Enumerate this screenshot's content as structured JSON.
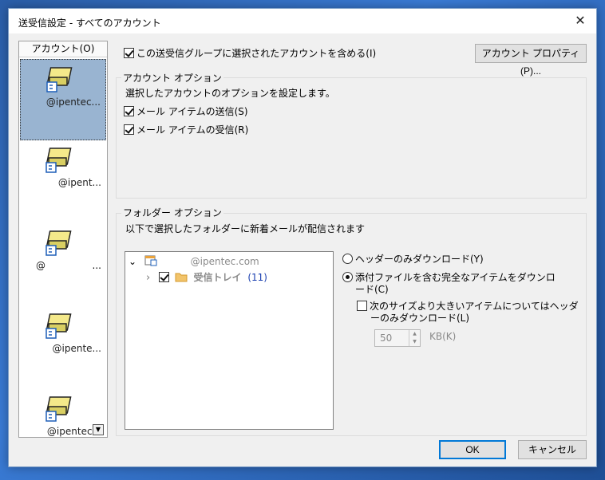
{
  "window": {
    "title": "送受信設定 - すべてのアカウント",
    "close_glyph": "✕"
  },
  "accounts": {
    "header": "アカウント(O)",
    "items": [
      {
        "label": "@ipentec...",
        "selected": true
      },
      {
        "label": "@ipent..."
      },
      {
        "label": "@",
        "suffix": "..."
      },
      {
        "label": "@ipente..."
      },
      {
        "label": "@ipentec..."
      }
    ],
    "scroll_glyph": "▼"
  },
  "include_account": {
    "label": "この送受信グループに選択されたアカウントを含める(I)",
    "checked": true
  },
  "account_properties_button": "アカウント プロパティ(P)...",
  "account_options": {
    "legend": "アカウント オプション",
    "description": "選択したアカウントのオプションを設定します。",
    "send_label": "メール アイテムの送信(S)",
    "send_checked": true,
    "receive_label": "メール アイテムの受信(R)",
    "receive_checked": true
  },
  "folder_options": {
    "legend": "フォルダー オプション",
    "description": "以下で選択したフォルダーに新着メールが配信されます",
    "tree": {
      "root_label": "@ipentec.com",
      "child_label": "受信トレイ",
      "child_count": "(11)",
      "expand_glyph": "⌄",
      "collapsed_glyph": "›"
    },
    "headers_only_label": "ヘッダーのみダウンロード(Y)",
    "full_items_label_line1": "添付ファイルを含む完全なアイテムをダウンロ",
    "full_items_label_line2": "ード(C)",
    "size_limit_label_line1": "次のサイズより大きいアイテムについてはヘッダ",
    "size_limit_label_line2": "ーのみダウンロード(L)",
    "size_value": "50",
    "size_unit": "KB(K)"
  },
  "ok_button": "OK",
  "cancel_button": "キャンセル",
  "colors": {
    "selection": "#99b4d1",
    "count": "#1a3fb0",
    "button_focus": "#0078d7"
  }
}
